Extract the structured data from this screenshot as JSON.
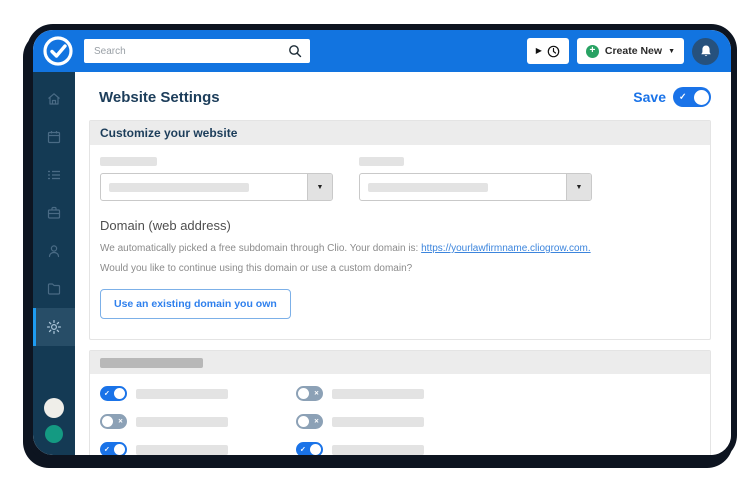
{
  "colors": {
    "topbar_blue": "#1274e0",
    "sidebar_navy": "#143a54",
    "frame_dark": "#0d1420",
    "accent_blue": "#1a73e8",
    "toggle_off_slate": "#8ca1b6",
    "create_plus_green": "#28a263",
    "bell_circle_navy": "#26517d",
    "avatar_teal": "#149a82",
    "header_gray": "#ececec",
    "skeleton_gray": "#e3e3e3",
    "link_blue": "#3c85dd"
  },
  "icons": {
    "play": "▶",
    "plus": "+",
    "caret_down": "▼",
    "select_caret": "▼",
    "check": "✓",
    "cross": "✕"
  },
  "topbar": {
    "search_placeholder": "Search",
    "create_new_label": "Create New"
  },
  "sidebar": {
    "items": [
      {
        "icon": "home-icon"
      },
      {
        "icon": "calendar-icon"
      },
      {
        "icon": "list-icon"
      },
      {
        "icon": "briefcase-icon"
      },
      {
        "icon": "person-icon"
      },
      {
        "icon": "folder-icon"
      },
      {
        "icon": "gear-icon",
        "active": true
      }
    ]
  },
  "page": {
    "title": "Website Settings",
    "save_label": "Save",
    "save_state": "on"
  },
  "customize": {
    "header": "Customize your website"
  },
  "domain": {
    "heading": "Domain (web address)",
    "line1_prefix": "We automatically picked a free subdomain through Clio. Your domain is: ",
    "link_text": "https://yourlawfirmname.cliogrow.com.",
    "line2": "Would you like to continue using this domain or use a custom domain?",
    "button_label": "Use an existing domain you own"
  },
  "toggles": {
    "items": [
      {
        "state": "on"
      },
      {
        "state": "off"
      },
      {
        "state": "off"
      },
      {
        "state": "off"
      },
      {
        "state": "on"
      },
      {
        "state": "on"
      }
    ]
  }
}
